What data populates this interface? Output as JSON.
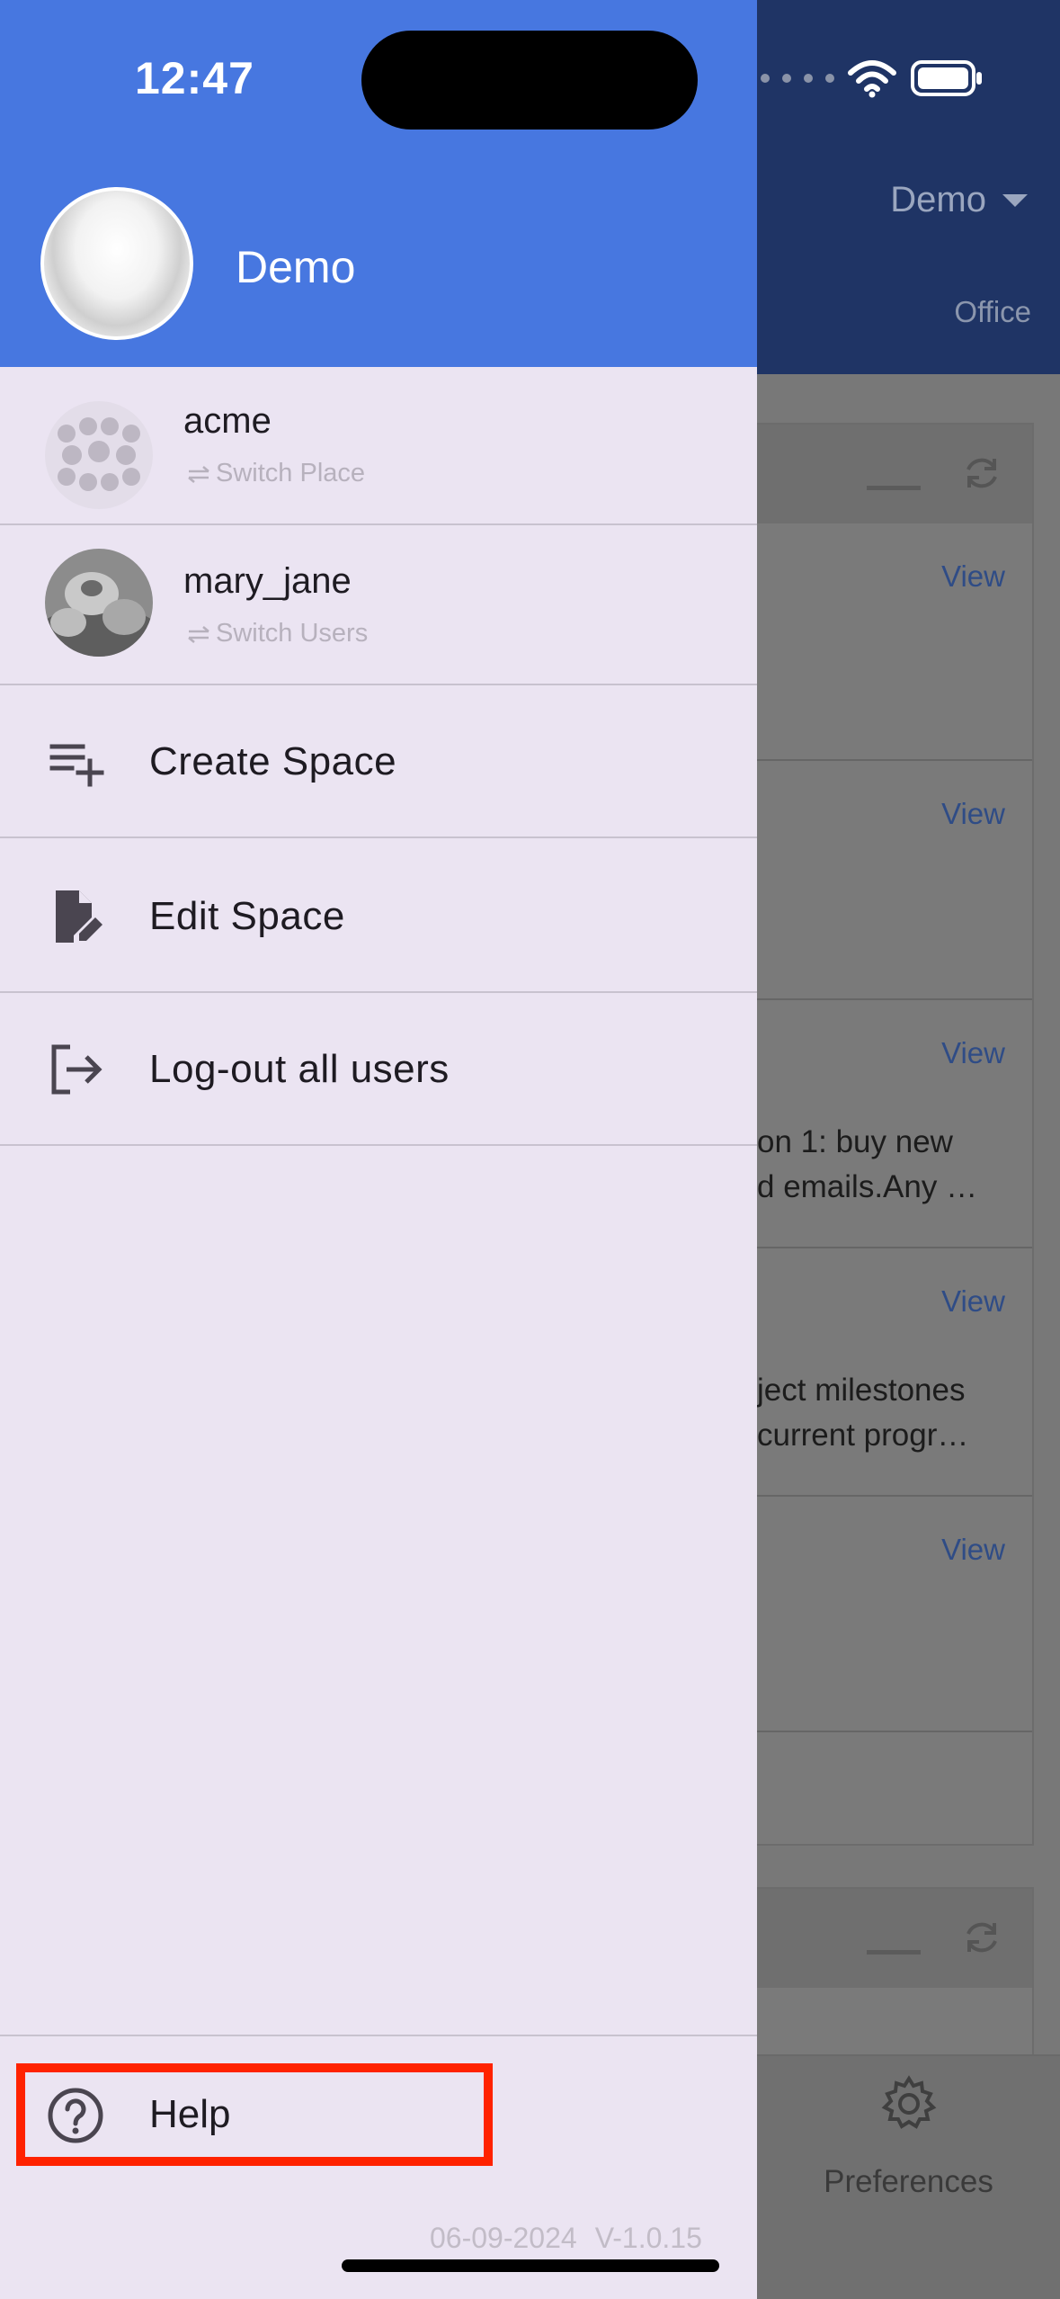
{
  "status": {
    "time": "12:47"
  },
  "background": {
    "place_label": "Demo",
    "office_label": "Office",
    "view_label": "View",
    "snippets": [
      [
        "on 1: buy new",
        "d emails.Any …"
      ],
      [
        "ject milestones",
        " current progr…"
      ]
    ],
    "tab_label": "Preferences"
  },
  "profile": {
    "name": "Demo"
  },
  "accounts": [
    {
      "name": "acme",
      "action": "Switch Place",
      "avatar_icon": "blurred-logo"
    },
    {
      "name": "mary_jane",
      "action": "Switch Users",
      "avatar_icon": "photo"
    }
  ],
  "menu": [
    {
      "label": "Create Space",
      "icon": "playlist-add-icon"
    },
    {
      "label": "Edit Space",
      "icon": "edit-document-icon"
    },
    {
      "label": "Log-out all users",
      "icon": "logout-icon"
    }
  ],
  "help": {
    "label": "Help",
    "icon": "help-circle-icon"
  },
  "footer": {
    "date": "06-09-2024",
    "version": "V-1.0.15"
  },
  "colors": {
    "drawer_header": "#4777e0",
    "drawer_bg": "#ebe4f2",
    "highlight": "#ff2200"
  }
}
